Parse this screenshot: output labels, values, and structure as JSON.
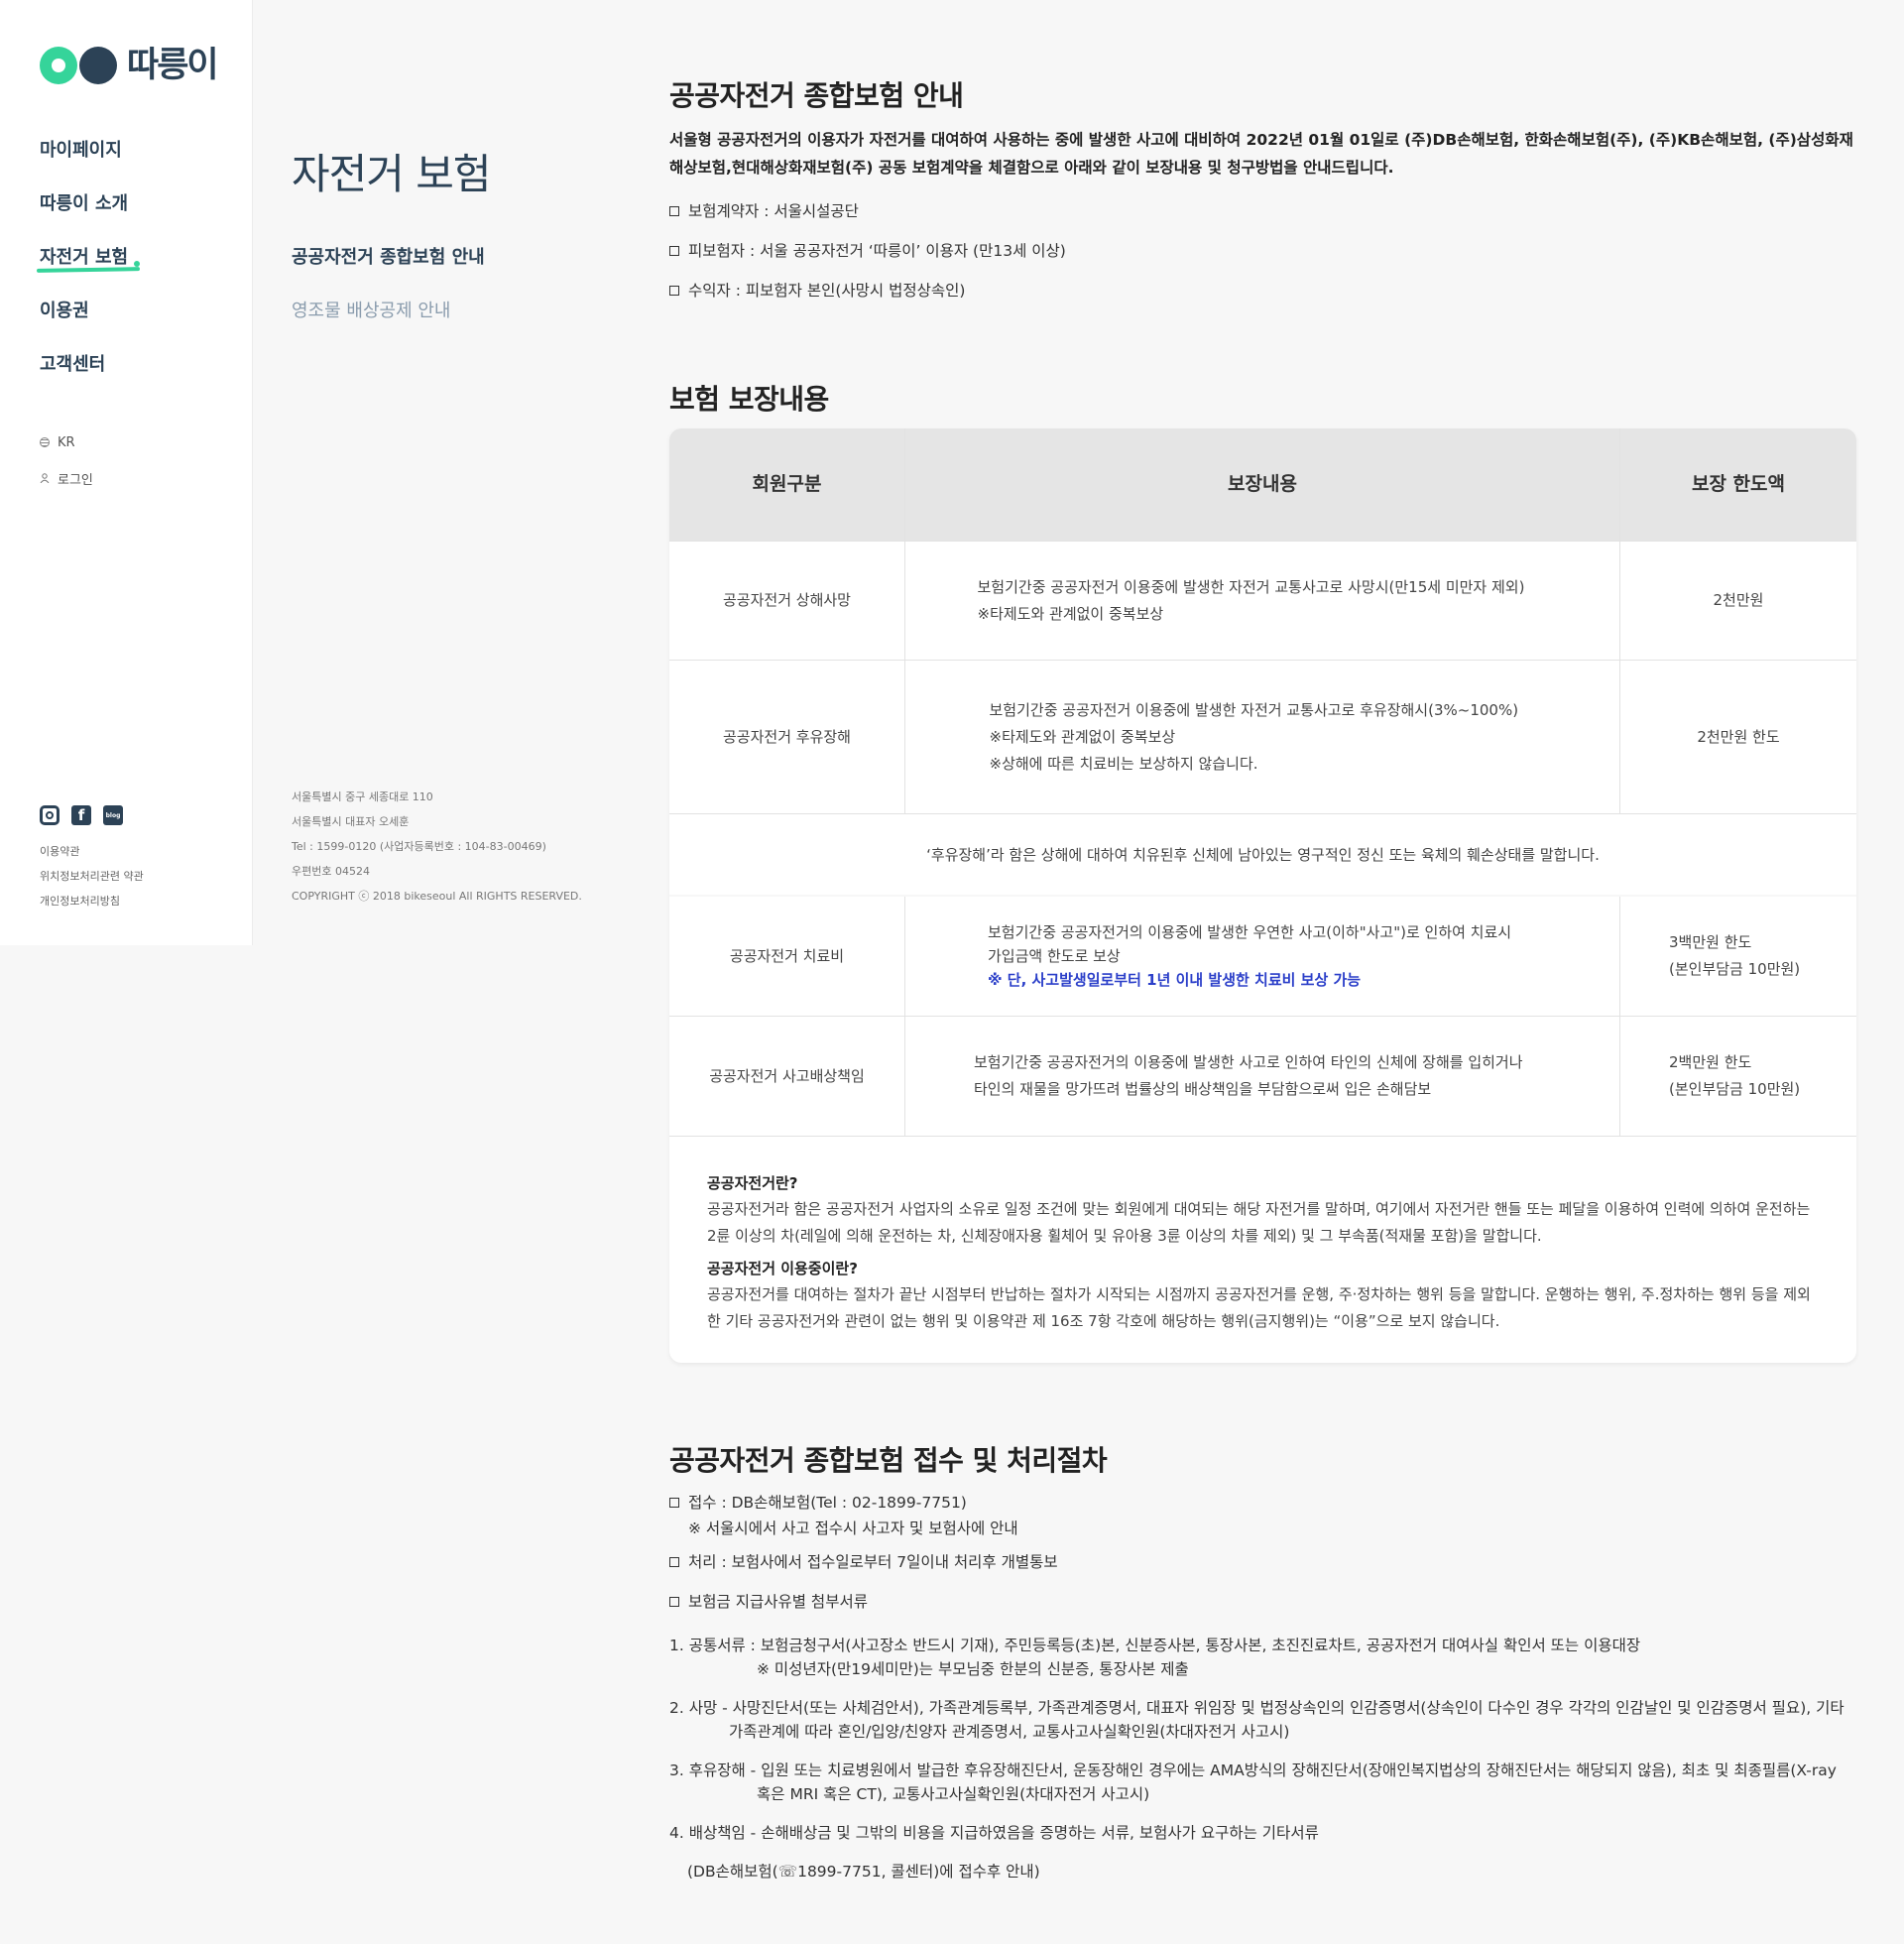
{
  "brand": {
    "wordmark": "따릉이",
    "green": "#35d49a",
    "navy": "#2c4256"
  },
  "gnb": {
    "menu": [
      "마이페이지",
      "따릉이 소개",
      "자전거 보험",
      "이용권",
      "고객센터"
    ],
    "active_index": 2,
    "lang": "KR",
    "login": "로그인",
    "sns": [
      {
        "icon": "instagram-icon",
        "label": ""
      },
      {
        "icon": "facebook-icon",
        "label": "f"
      },
      {
        "icon": "blog-icon",
        "label": "blog"
      }
    ],
    "links": [
      "이용약관",
      "위치정보처리관련 약관",
      "개인정보처리방침"
    ]
  },
  "lnb": {
    "title": "자전거 보험",
    "items": [
      "공공자전거 종합보험 안내",
      "영조물 배상공제 안내"
    ],
    "footer": [
      "서울특별시 중구 세종대로 110",
      "서울특별시 대표자 오세훈",
      "Tel : 1599-0120 (사업자등록번호 : 104-83-00469)",
      "우편번호 04524",
      "COPYRIGHT ⓒ 2018 bikeseoul All RIGHTS RESERVED."
    ]
  },
  "section1": {
    "title": "공공자전거 종합보험 안내",
    "lead": "서울형 공공자전거의 이용자가 자전거를 대여하여 사용하는 중에 발생한 사고에 대비하여 2022년 01월 01일로 (주)DB손해보험, 한화손해보험(주), (주)KB손해보험, (주)삼성화재해상보험,현대해상화재보험(주) 공동 보험계약을 체결함으로 아래와 같이 보장내용 및 청구방법을 안내드립니다.",
    "bullets": [
      "보험계약자 : 서울시설공단",
      "피보험자 : 서울 공공자전거 ‘따릉이’ 이용자  (만13세 이상)",
      "수익자 : 피보험자 본인(사망시 법정상속인)"
    ]
  },
  "section2": {
    "title": "보험 보장내용",
    "headers": [
      "회원구분",
      "보장내용",
      "보장 한도액"
    ],
    "rows": [
      {
        "type": "상해사망",
        "label": "공공자전거 상해사망",
        "lines": [
          "보험기간중 공공자전거 이용중에 발생한 자전거 교통사고로 사망시(만15세 미만자 제외)",
          "※타제도와 관계없이 중복보상"
        ],
        "limit": [
          "2천만원"
        ]
      },
      {
        "label": "공공자전거 후유장해",
        "lines": [
          "보험기간중 공공자전거 이용중에 발생한 자전거 교통사고로 후유장해시(3%~100%)",
          "※타제도와 관계없이 중복보상",
          "※상해에 따른 치료비는 보상하지 않습니다."
        ],
        "limit": [
          "2천만원 한도"
        ]
      },
      {
        "label": "공공자전거 치료비",
        "lines": [
          "보험기간중 공공자전거의 이용중에 발생한 우연한 사고(이하\"사고\")로 인하여 치료시",
          "가입금액 한도로 보상"
        ],
        "highlight": "※ 단, 사고발생일로부터 1년 이내 발생한 치료비 보상 가능",
        "limit": [
          "3백만원 한도",
          "(본인부담금 10만원)"
        ]
      },
      {
        "label": "공공자전거 사고배상책임",
        "lines": [
          "보험기간중 공공자전거의 이용중에 발생한 사고로 인하여 타인의 신체에 장해를 입히거나",
          "타인의 재물을 망가뜨려 법률상의 배상책임을 부담함으로써 입은 손해담보"
        ],
        "limit": [
          "2백만원 한도",
          "(본인부담금 10만원)"
        ]
      }
    ],
    "disability_note": "‘후유장해’라 함은 상해에 대하여 치유된후 신체에 남아있는 영구적인 정신 또는 육체의 훼손상태를 말합니다.",
    "definitions": [
      {
        "term": "공공자전거란?",
        "desc": "공공자전거라 함은 공공자전거 사업자의 소유로 일정 조건에 맞는 회원에게 대여되는 해당 자전거를 말하며, 여기에서 자전거란 핸들 또는 페달을 이용하여 인력에 의하여 운전하는 2륜 이상의 차(레일에 의해 운전하는 차, 신체장애자용 휠체어 및 유아용 3륜 이상의 차를 제외) 및 그 부속품(적재물 포함)을 말합니다."
      },
      {
        "term": "공공자전거 이용중이란?",
        "desc": "공공자전거를 대여하는 절차가 끝난 시점부터 반납하는 절차가 시작되는 시점까지 공공자전거를 운행, 주·정차하는 행위 등을 말합니다. 운행하는 행위, 주.정차하는 행위 등을 제외한 기타 공공자전거와 관련이 없는 행위 및 이용약관 제 16조 7항 각호에 해당하는 행위(금지행위)는 “이용”으로 보지 않습니다."
      }
    ]
  },
  "section3": {
    "title": "공공자전거 종합보험 접수 및 처리절차",
    "bullets": [
      {
        "text": "접수 : DB손해보험(Tel : 02-1899-7751)",
        "note": "※ 서울시에서 사고 접수시 사고자 및 보험사에 안내"
      },
      {
        "text": "처리 : 보험사에서 접수일로부터 7일이내 처리후 개별통보"
      },
      {
        "text": "보험금 지급사유별 첨부서류"
      }
    ],
    "documents": [
      {
        "main": "1. 공통서류 : 보험금청구서(사고장소 반드시 기재), 주민등록등(초)본, 신분증사본, 통장사본, 초진진료차트, 공공자전거 대여사실 확인서 또는 이용대장",
        "sub": "※ 미성년자(만19세미만)는 부모님중 한분의 신분증, 통장사본 제출",
        "indent": 88
      },
      {
        "main": "2. 사망 - 사망진단서(또는 사체검안서), 가족관계등록부, 가족관계증명서, 대표자 위임장 및 법정상속인의 인감증명서(상속인이 다수인 경우 각각의 인감날인 및 인감증명서 필요), 기타",
        "sub": "가족관계에 따라 혼인/입양/친양자 관계증명서, 교통사고사실확인원(차대자전거 사고시)",
        "indent": 60
      },
      {
        "main": "3. 후유장해 - 입원 또는 치료병원에서 발급한 후유장해진단서, 운동장해인 경우에는 AMA방식의 장해진단서(장애인복지법상의 장해진단서는 해당되지 않음), 최초 및 최종필름(X-ray",
        "sub": "혹은 MRI 혹은 CT), 교통사고사실확인원(차대자전거 사고시)",
        "indent": 88
      },
      {
        "main": "4. 배상책임 - 손해배상금 및 그밖의 비용을 지급하였음을 증명하는 서류, 보험사가 요구하는 기타서류",
        "sub": "",
        "indent": 0
      }
    ],
    "final_note": "(DB손해보험(☏1899-7751, 콜센터)에 접수후 안내)"
  }
}
